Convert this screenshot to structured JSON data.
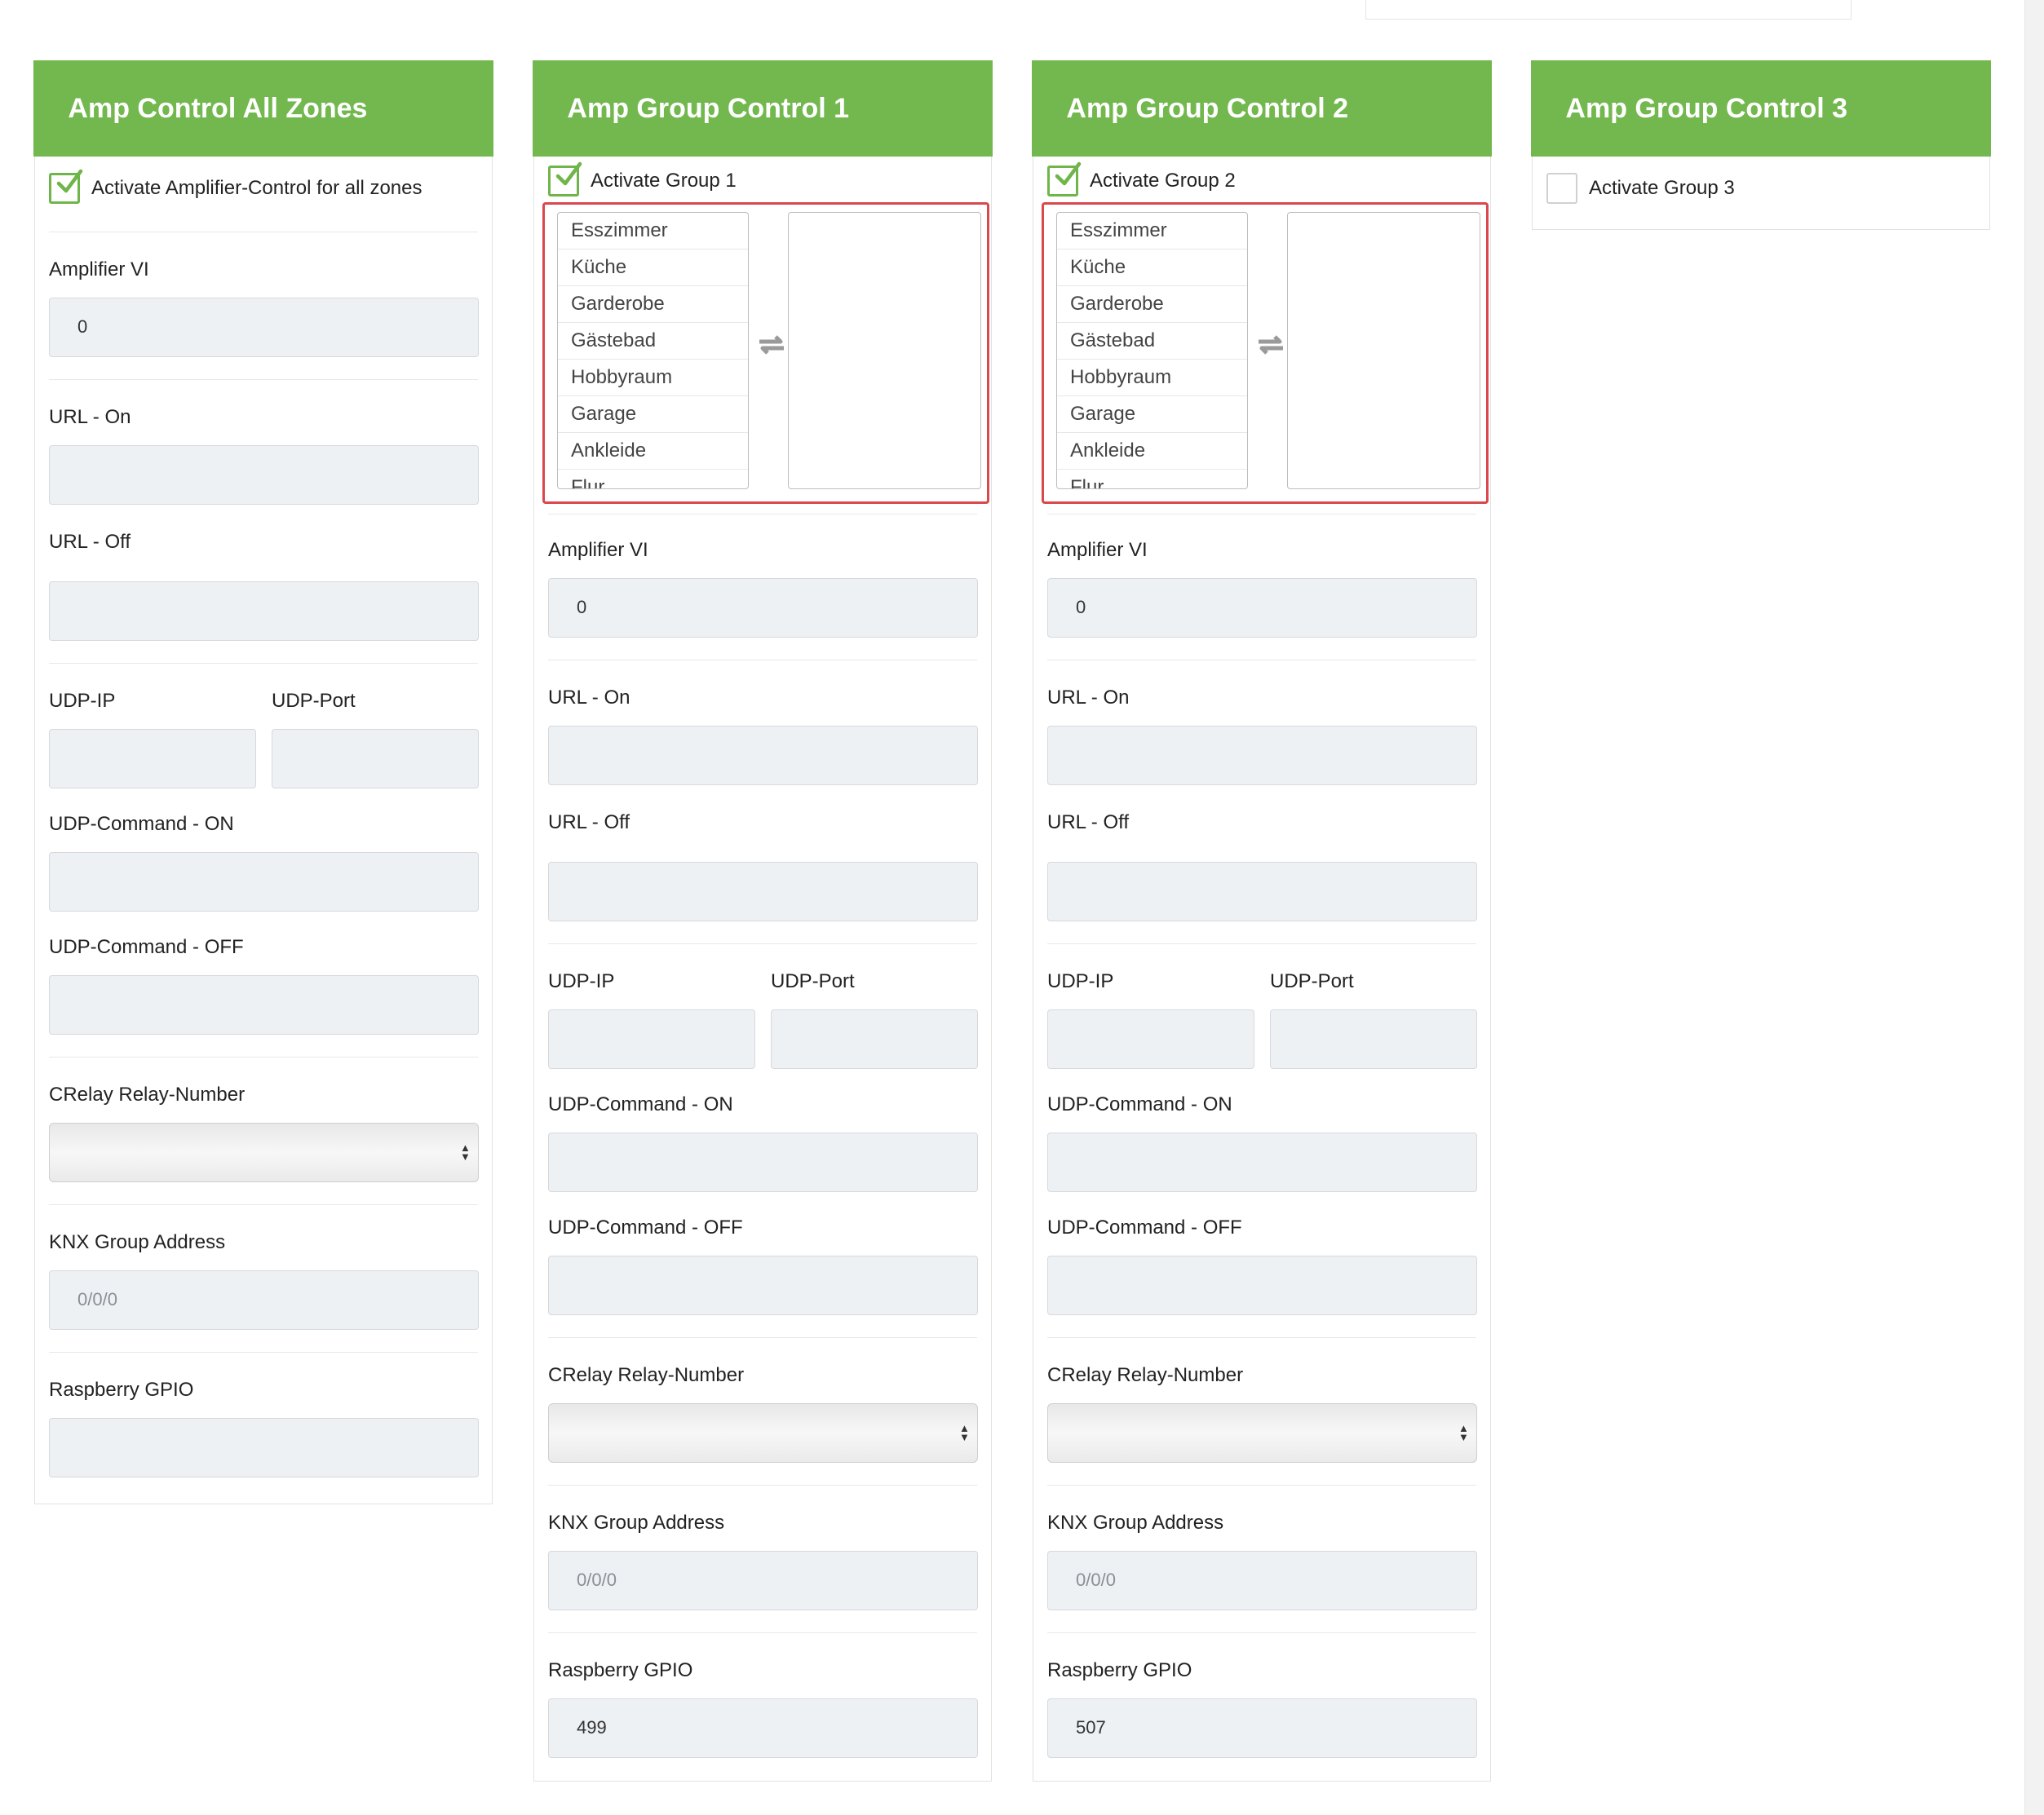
{
  "panels": [
    {
      "title": "Amp Control All Zones",
      "checkbox_label": "Activate Amplifier-Control for all zones",
      "checked": true,
      "amplifier_vi_label": "Amplifier VI",
      "amplifier_vi_value": "0",
      "url_on_label": "URL - On",
      "url_off_label": "URL - Off",
      "udp_ip_label": "UDP-IP",
      "udp_port_label": "UDP-Port",
      "udp_cmd_on_label": "UDP-Command - ON",
      "udp_cmd_off_label": "UDP-Command - OFF",
      "crelay_label": "CRelay Relay-Number",
      "knx_label": "KNX Group Address",
      "knx_placeholder": "0/0/0",
      "gpio_label": "Raspberry GPIO",
      "gpio_value": ""
    },
    {
      "title": "Amp Group Control 1",
      "checkbox_label": "Activate Group 1",
      "checked": true,
      "rooms": [
        "Esszimmer",
        "Küche",
        "Garderobe",
        "Gästebad",
        "Hobbyraum",
        "Garage",
        "Ankleide",
        "Flur"
      ],
      "amplifier_vi_label": "Amplifier VI",
      "amplifier_vi_value": "0",
      "url_on_label": "URL - On",
      "url_off_label": "URL - Off",
      "udp_ip_label": "UDP-IP",
      "udp_port_label": "UDP-Port",
      "udp_cmd_on_label": "UDP-Command - ON",
      "udp_cmd_off_label": "UDP-Command - OFF",
      "crelay_label": "CRelay Relay-Number",
      "knx_label": "KNX Group Address",
      "knx_placeholder": "0/0/0",
      "gpio_label": "Raspberry GPIO",
      "gpio_value": "499"
    },
    {
      "title": "Amp Group Control 2",
      "checkbox_label": "Activate Group 2",
      "checked": true,
      "rooms": [
        "Esszimmer",
        "Küche",
        "Garderobe",
        "Gästebad",
        "Hobbyraum",
        "Garage",
        "Ankleide",
        "Flur"
      ],
      "amplifier_vi_label": "Amplifier VI",
      "amplifier_vi_value": "0",
      "url_on_label": "URL - On",
      "url_off_label": "URL - Off",
      "udp_ip_label": "UDP-IP",
      "udp_port_label": "UDP-Port",
      "udp_cmd_on_label": "UDP-Command - ON",
      "udp_cmd_off_label": "UDP-Command - OFF",
      "crelay_label": "CRelay Relay-Number",
      "knx_label": "KNX Group Address",
      "knx_placeholder": "0/0/0",
      "gpio_label": "Raspberry GPIO",
      "gpio_value": "507"
    },
    {
      "title": "Amp Group Control 3",
      "checkbox_label": "Activate Group 3",
      "checked": false
    }
  ],
  "colors": {
    "header_green": "#73b84e",
    "check_green": "#6fb54a",
    "highlight_red": "#d9484d",
    "input_bg": "#eef1f4"
  },
  "icons": {
    "check": "checkmark-icon",
    "swap": "swap-arrows-icon",
    "select_arrows": "select-updown-icon"
  }
}
